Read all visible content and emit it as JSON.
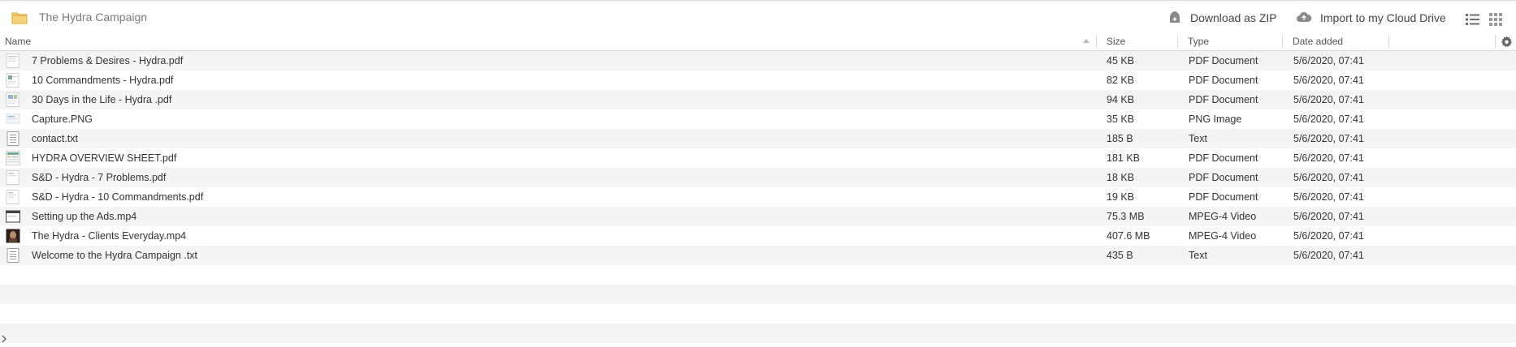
{
  "header": {
    "folder_title": "The Hydra Campaign",
    "download_zip_label": "Download as ZIP",
    "import_cloud_label": "Import to my Cloud Drive"
  },
  "columns": {
    "name": "Name",
    "size": "Size",
    "type": "Type",
    "date": "Date added"
  },
  "files": [
    {
      "name": "7 Problems & Desires - Hydra.pdf",
      "size": "45 KB",
      "type": "PDF Document",
      "date": "5/6/2020, 07:41",
      "thumb": "doc-thumb"
    },
    {
      "name": "10 Commandments - Hydra.pdf",
      "size": "82 KB",
      "type": "PDF Document",
      "date": "5/6/2020, 07:41",
      "thumb": "doc-thumb"
    },
    {
      "name": "30 Days in the Life - Hydra .pdf",
      "size": "94 KB",
      "type": "PDF Document",
      "date": "5/6/2020, 07:41",
      "thumb": "doc-thumb"
    },
    {
      "name": "Capture.PNG",
      "size": "35 KB",
      "type": "PNG Image",
      "date": "5/6/2020, 07:41",
      "thumb": "image-thumb"
    },
    {
      "name": "contact.txt",
      "size": "185 B",
      "type": "Text",
      "date": "5/6/2020, 07:41",
      "thumb": "text-file-icon"
    },
    {
      "name": "HYDRA OVERVIEW SHEET.pdf",
      "size": "181 KB",
      "type": "PDF Document",
      "date": "5/6/2020, 07:41",
      "thumb": "sheet-thumb"
    },
    {
      "name": "S&D - Hydra - 7 Problems.pdf",
      "size": "18 KB",
      "type": "PDF Document",
      "date": "5/6/2020, 07:41",
      "thumb": "doc-thumb"
    },
    {
      "name": "S&D - Hydra - 10 Commandments.pdf",
      "size": "19 KB",
      "type": "PDF Document",
      "date": "5/6/2020, 07:41",
      "thumb": "doc-thumb"
    },
    {
      "name": "Setting up the Ads.mp4",
      "size": "75.3 MB",
      "type": "MPEG-4 Video",
      "date": "5/6/2020, 07:41",
      "thumb": "video-thumb"
    },
    {
      "name": "The Hydra - Clients Everyday.mp4",
      "size": "407.6 MB",
      "type": "MPEG-4 Video",
      "date": "5/6/2020, 07:41",
      "thumb": "video-dark-thumb"
    },
    {
      "name": "Welcome to the Hydra Campaign .txt",
      "size": "435 B",
      "type": "Text",
      "date": "5/6/2020, 07:41",
      "thumb": "text-file-icon"
    }
  ],
  "icons": {
    "folder": "folder-icon",
    "zip": "lock-download-icon",
    "cloud": "cloud-upload-icon",
    "list_view": "list-view-icon",
    "grid_view": "grid-view-icon",
    "settings": "gear-icon",
    "sort": "sort-ascending-icon"
  },
  "colors": {
    "folder": "#f3c761",
    "row_alt": "#f5f5f5",
    "text": "#333333",
    "muted": "#7a7a7a"
  }
}
